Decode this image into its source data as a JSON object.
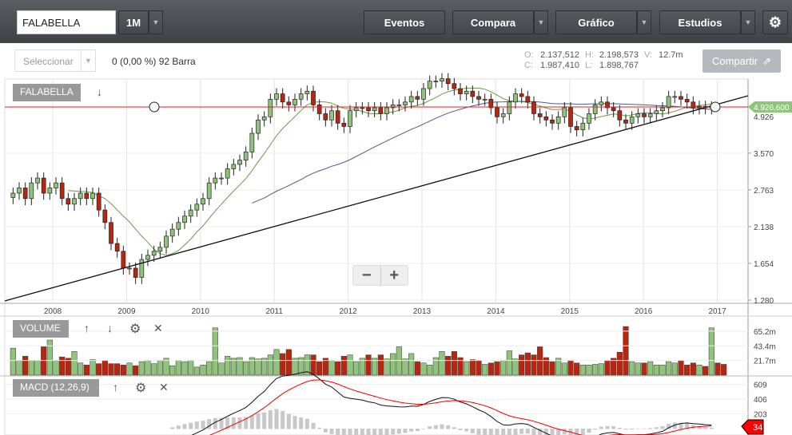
{
  "toolbar": {
    "symbol": "FALABELLA",
    "period": "1M",
    "eventos": "Eventos",
    "compara": "Compara",
    "grafico": "Gráfico",
    "estudios": "Estudios"
  },
  "subbar": {
    "select_placeholder": "Seleccionar",
    "change": "0 (0,00 %) 92 Barra",
    "share": "Compartir"
  },
  "ohlc": {
    "o_label": "O:",
    "o": "2.137,512",
    "h_label": "H:",
    "h": "2.198,573",
    "v_label": "V:",
    "v": "12.7m",
    "c_label": "C:",
    "c": "1.987,410",
    "l_label": "L:",
    "l": "1.898,767"
  },
  "panels": {
    "main_label": "FALABELLA",
    "volume_label": "VOLUME",
    "macd_label": "MACD (12,26,9)"
  },
  "zoom": {
    "minus": "−",
    "plus": "+"
  },
  "colors": {
    "up": "#8fc47a",
    "down": "#b8260f",
    "ma_fast": "#6a9a4a",
    "ma_slow": "#4a5e88",
    "hline": "#e02020"
  },
  "chart_data": {
    "type": "candlestick",
    "start": "2007-06",
    "interval": "1M",
    "close": [
      2.7,
      2.8,
      2.6,
      2.9,
      3.0,
      2.7,
      2.8,
      2.9,
      2.6,
      2.5,
      2.6,
      2.7,
      2.6,
      2.7,
      2.4,
      2.2,
      1.9,
      1.8,
      1.6,
      1.6,
      1.5,
      1.7,
      1.75,
      1.8,
      1.85,
      2.0,
      2.1,
      2.2,
      2.3,
      2.4,
      2.5,
      2.6,
      2.9,
      3.0,
      3.0,
      3.2,
      3.3,
      3.4,
      3.6,
      4.1,
      4.5,
      4.6,
      5.2,
      5.4,
      5.1,
      5.0,
      5.2,
      5.4,
      5.5,
      5.0,
      4.7,
      4.5,
      4.8,
      4.4,
      4.3,
      4.8,
      4.9,
      4.9,
      4.8,
      4.9,
      4.7,
      4.9,
      5.0,
      5.0,
      5.1,
      5.3,
      5.2,
      5.6,
      5.9,
      5.9,
      6.0,
      5.8,
      5.6,
      5.4,
      5.5,
      5.3,
      5.2,
      5.2,
      4.9,
      4.6,
      4.7,
      5.1,
      5.4,
      5.3,
      5.1,
      4.7,
      4.6,
      4.5,
      4.4,
      4.6,
      4.9,
      4.3,
      4.2,
      4.4,
      4.7,
      5.0,
      5.1,
      4.9,
      4.8,
      4.5,
      4.4,
      4.6,
      4.7,
      4.6,
      4.7,
      4.8,
      4.9,
      5.3,
      5.3,
      5.2,
      5.1,
      4.9,
      4.95,
      4.9,
      4.93
    ],
    "volume": [
      40,
      22,
      28,
      22,
      22,
      42,
      52,
      22,
      27,
      25,
      35,
      18,
      15,
      23,
      17,
      22,
      17,
      17,
      15,
      18,
      14,
      20,
      22,
      17,
      22,
      25,
      14,
      22,
      20,
      22,
      12,
      15,
      20,
      70,
      18,
      28,
      25,
      26,
      20,
      26,
      24,
      25,
      30,
      38,
      32,
      38,
      25,
      26,
      30,
      30,
      20,
      25,
      22,
      20,
      28,
      30,
      20,
      25,
      30,
      25,
      30,
      24,
      32,
      42,
      24,
      32,
      20,
      18,
      15,
      26,
      35,
      28,
      35,
      26,
      20,
      23,
      22,
      16,
      18,
      20,
      22,
      36,
      24,
      30,
      33,
      30,
      42,
      26,
      20,
      25,
      18,
      22,
      18,
      15,
      15,
      16,
      17,
      22,
      25,
      34,
      72,
      20,
      18,
      18,
      20,
      15,
      15,
      20,
      18,
      22,
      15,
      18,
      15,
      13,
      70,
      18,
      16
    ],
    "volume_unit": "m",
    "y_ticks": [
      "1.280",
      "1.654",
      "2.138",
      "2.763",
      "3.570",
      "4.926,600"
    ],
    "x_ticks": [
      "2008",
      "2009",
      "2010",
      "2011",
      "2012",
      "2013",
      "2014",
      "2015",
      "2016",
      "2017"
    ],
    "volume_ticks": [
      "65.2m",
      "43.4m",
      "21.7m"
    ],
    "macd_ticks": [
      "609",
      "406",
      "203"
    ],
    "last_price": "4.926,600",
    "macd_last": "34",
    "scale": "log"
  }
}
